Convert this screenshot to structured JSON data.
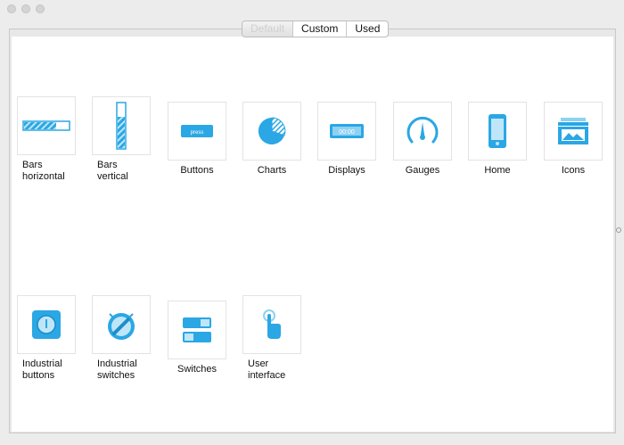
{
  "window": {
    "controls": [
      "close",
      "minimize",
      "zoom"
    ]
  },
  "tabs": [
    {
      "label": "Default",
      "active": true
    },
    {
      "label": "Custom",
      "active": false
    },
    {
      "label": "Used",
      "active": false
    }
  ],
  "accent_color": "#2aa7e4",
  "categories": [
    {
      "line1": "Bars",
      "line2": "horizontal",
      "icon": "horizontal-bar-icon"
    },
    {
      "line1": "Bars",
      "line2": "vertical",
      "icon": "vertical-bar-icon"
    },
    {
      "line1": "Buttons",
      "icon": "press-button-icon",
      "icon_text": "press"
    },
    {
      "line1": "Charts",
      "icon": "pie-chart-icon"
    },
    {
      "line1": "Displays",
      "icon": "digital-display-icon",
      "icon_text": "00:00"
    },
    {
      "line1": "Gauges",
      "icon": "gauge-icon"
    },
    {
      "line1": "Home",
      "icon": "phone-icon"
    },
    {
      "line1": "Icons",
      "icon": "image-icon"
    },
    {
      "line1": "Industrial",
      "line2": "buttons",
      "icon": "industrial-button-icon"
    },
    {
      "line1": "Industrial",
      "line2": "switches",
      "icon": "industrial-switch-icon"
    },
    {
      "line1": "Switches",
      "icon": "toggle-switch-icon"
    },
    {
      "line1": "User",
      "line2": "interface",
      "icon": "touch-hand-icon"
    }
  ]
}
